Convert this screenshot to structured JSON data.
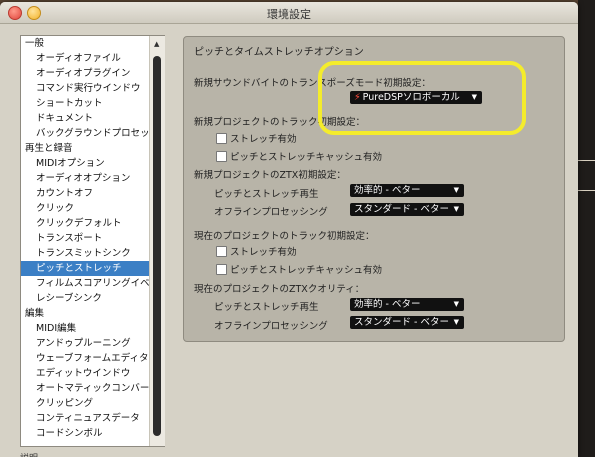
{
  "window": {
    "title": "環境設定"
  },
  "sidebar": {
    "items": [
      {
        "label": "一般",
        "type": "cat"
      },
      {
        "label": "オーディオファイル",
        "type": "sub"
      },
      {
        "label": "オーディオプラグイン",
        "type": "sub"
      },
      {
        "label": "コマンド実行ウインドウ",
        "type": "sub"
      },
      {
        "label": "ショートカット",
        "type": "sub"
      },
      {
        "label": "ドキュメント",
        "type": "sub"
      },
      {
        "label": "バックグラウンドプロセッサ",
        "type": "sub"
      },
      {
        "label": "再生と録音",
        "type": "cat"
      },
      {
        "label": "MIDIオプション",
        "type": "sub"
      },
      {
        "label": "オーディオオプション",
        "type": "sub"
      },
      {
        "label": "カウントオフ",
        "type": "sub"
      },
      {
        "label": "クリック",
        "type": "sub"
      },
      {
        "label": "クリックデフォルト",
        "type": "sub"
      },
      {
        "label": "トランスポート",
        "type": "sub"
      },
      {
        "label": "トランスミットシンク",
        "type": "sub"
      },
      {
        "label": "ピッチとストレッチ",
        "type": "sub",
        "selected": true
      },
      {
        "label": "フィルムスコアリングイベント",
        "type": "sub"
      },
      {
        "label": "レシーブシンク",
        "type": "sub"
      },
      {
        "label": "編集",
        "type": "cat"
      },
      {
        "label": "MIDI編集",
        "type": "sub"
      },
      {
        "label": "アンドゥプルーニング",
        "type": "sub"
      },
      {
        "label": "ウェーブフォームエディター",
        "type": "sub"
      },
      {
        "label": "エディットウインドウ",
        "type": "sub"
      },
      {
        "label": "オートマティックコンバージョン",
        "type": "sub"
      },
      {
        "label": "クリッピング",
        "type": "sub"
      },
      {
        "label": "コンティニュアスデータ",
        "type": "sub"
      },
      {
        "label": "コードシンボル",
        "type": "sub"
      }
    ]
  },
  "panel": {
    "title": "ピッチとタイムストレッチオプション",
    "transpose_label": "新規サウンドバイトのトランスポーズモード初期設定：",
    "transpose_value": "PureDSPソロボーカル",
    "new_project_label": "新規プロジェクトのトラック初期設定：",
    "new_stretch_cb": "ストレッチ有効",
    "new_cache_cb": "ピッチとストレッチキャッシュ有効",
    "new_ztx_label": "新規プロジェクトのZTX初期設定：",
    "new_pitch_label": "ピッチとストレッチ再生",
    "new_pitch_value": "効率的 - ベター",
    "new_offline_label": "オフラインプロセッシング",
    "new_offline_value": "スタンダード - ベター",
    "cur_project_label": "現在のプロジェクトのトラック初期設定：",
    "cur_stretch_cb": "ストレッチ有効",
    "cur_cache_cb": "ピッチとストレッチキャッシュ有効",
    "cur_ztx_label": "現在のプロジェクトのZTXクオリティ：",
    "cur_pitch_label": "ピッチとストレッチ再生",
    "cur_pitch_value": "効率的 - ベター",
    "cur_offline_label": "オフラインプロセッシング",
    "cur_offline_value": "スタンダード - ベター"
  },
  "bottom": {
    "label": "説明"
  },
  "colors": {
    "highlight": "#f4ec2c",
    "selection": "#3b7fc5",
    "popup_bg": "#111111"
  }
}
